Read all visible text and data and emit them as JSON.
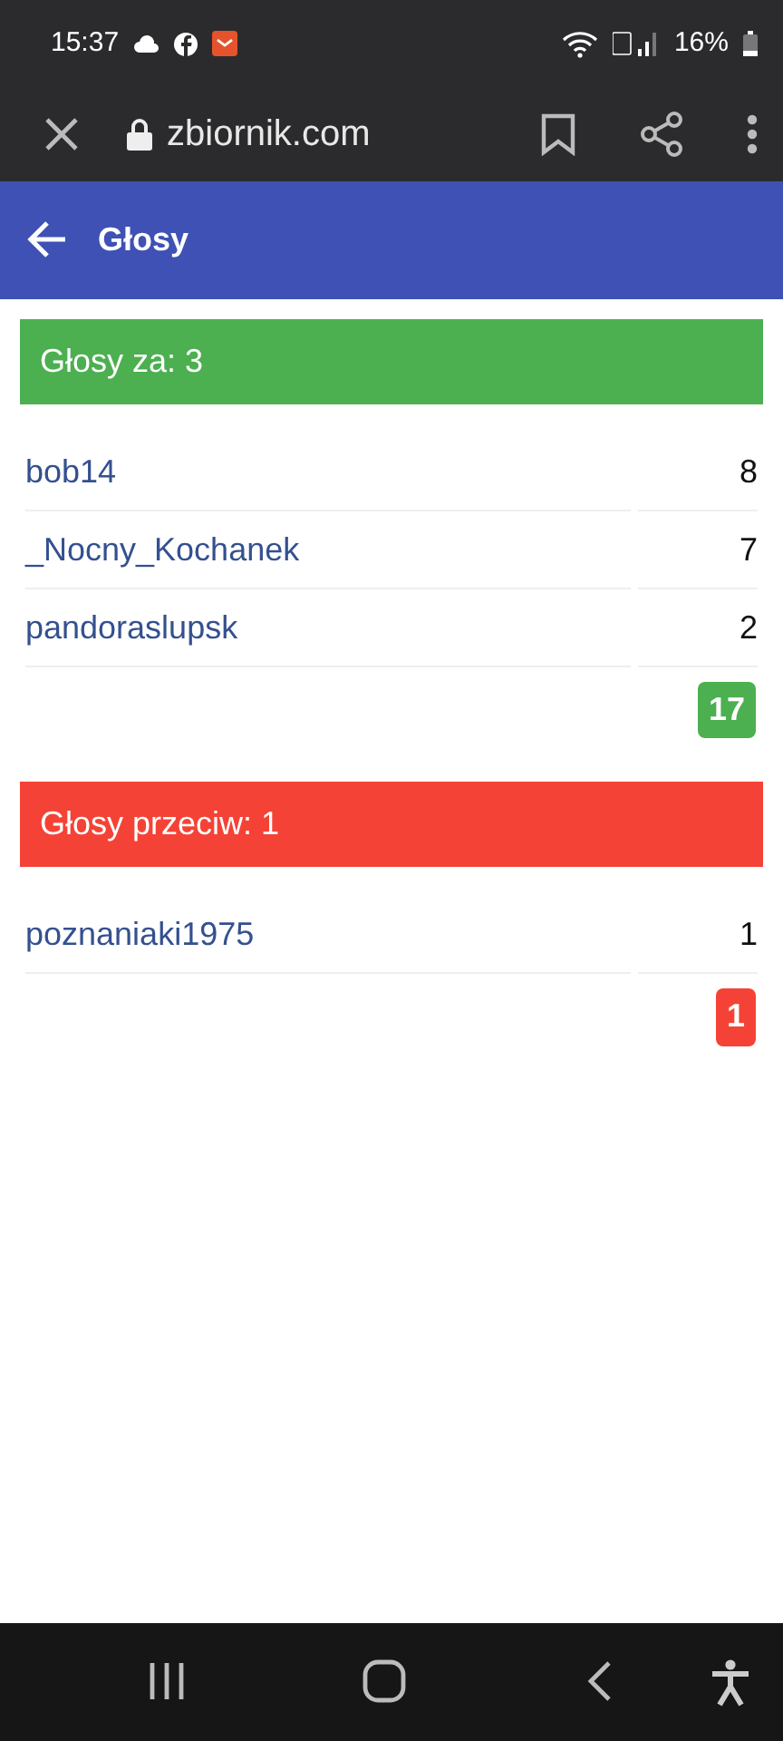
{
  "status_bar": {
    "time": "15:37",
    "battery": "16%"
  },
  "browser": {
    "url": "zbiornik.com"
  },
  "header": {
    "title": "Głosy"
  },
  "sections": [
    {
      "kind": "for",
      "title": "Głosy za: 3",
      "rows": [
        {
          "name": "bob14",
          "votes": "8"
        },
        {
          "name": "_Nocny_Kochanek",
          "votes": "7"
        },
        {
          "name": "pandoraslupsk",
          "votes": "2"
        }
      ],
      "total": "17"
    },
    {
      "kind": "against",
      "title": "Głosy przeciw: 1",
      "rows": [
        {
          "name": "poznaniaki1975",
          "votes": "1"
        }
      ],
      "total": "1"
    }
  ]
}
